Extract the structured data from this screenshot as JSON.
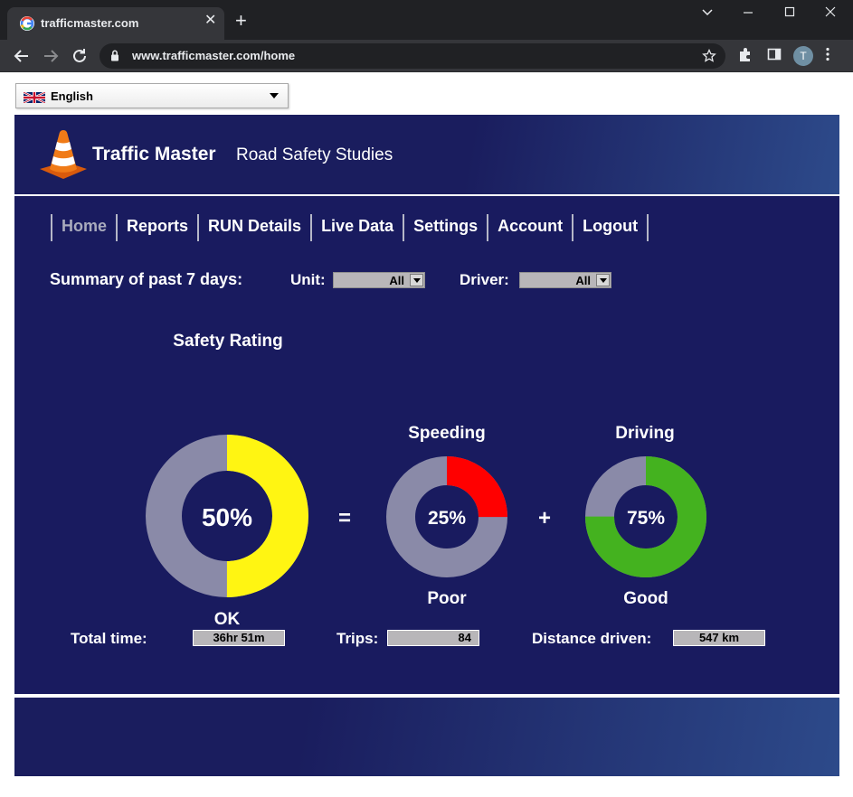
{
  "browser": {
    "tab_title": "trafficmaster.com",
    "url": "www.trafficmaster.com/home",
    "profile_initial": "T"
  },
  "language": {
    "selected": "English",
    "flag": "uk-flag-icon"
  },
  "header": {
    "brand": "Traffic Master",
    "subtitle": "Road Safety Studies"
  },
  "nav": [
    {
      "label": "Home",
      "active": true
    },
    {
      "label": "Reports"
    },
    {
      "label": "RUN Details"
    },
    {
      "label": "Live Data"
    },
    {
      "label": "Settings"
    },
    {
      "label": "Account"
    },
    {
      "label": "Logout"
    }
  ],
  "summary": {
    "label": "Summary of past 7 days:",
    "unit_label": "Unit:",
    "unit_value": "All",
    "driver_label": "Driver:",
    "driver_value": "All"
  },
  "ratings": {
    "safety": {
      "title": "Safety Rating",
      "value_text": "50%",
      "fraction": 0.5,
      "status": "OK",
      "color": "#fff512"
    },
    "speeding": {
      "title": "Speeding",
      "value_text": "25%",
      "fraction": 0.25,
      "status": "Poor",
      "color": "#ff0000"
    },
    "driving": {
      "title": "Driving",
      "value_text": "75%",
      "fraction": 0.75,
      "status": "Good",
      "color": "#44b21f"
    },
    "track_color": "#8a8aa8",
    "equals": "=",
    "plus": "+"
  },
  "stats": {
    "total_time_label": "Total time:",
    "total_time_value": "36hr 51m",
    "trips_label": "Trips:",
    "trips_value": "84",
    "distance_label": "Distance driven:",
    "distance_value": "547 km"
  },
  "colors": {
    "main_bg": "#191b5f",
    "nav_active": "#a9abbd",
    "field_bg": "#b8b6b9"
  }
}
